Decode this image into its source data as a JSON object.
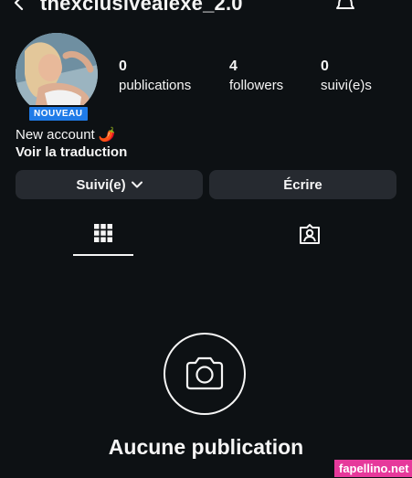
{
  "header": {
    "username": "thexclusivealexe_2.0",
    "back_icon": "chevron-left-icon",
    "bell_icon": "bell-icon",
    "more_icon": "more-horizontal-icon"
  },
  "profile": {
    "avatar_icon": "avatar",
    "badge": "NOUVEAU",
    "bio": "New account 🌶️",
    "translate": "Voir la traduction"
  },
  "stats": [
    {
      "value": "0",
      "label": "publications"
    },
    {
      "value": "4",
      "label": "followers"
    },
    {
      "value": "0",
      "label": "suivi(e)s"
    }
  ],
  "actions": {
    "follow_label": "Suivi(e)",
    "message_label": "Écrire"
  },
  "tabs": [
    {
      "icon": "grid-icon",
      "active": true
    },
    {
      "icon": "tagged-icon",
      "active": false
    }
  ],
  "empty_state": {
    "icon": "camera-icon",
    "title": "Aucune publication"
  },
  "watermark": "fapellino.net",
  "colors": {
    "background": "#0d1114",
    "button": "#262a30",
    "badge": "#1f7be8",
    "watermark": "#e6399b",
    "text": "#f5f5f5"
  }
}
